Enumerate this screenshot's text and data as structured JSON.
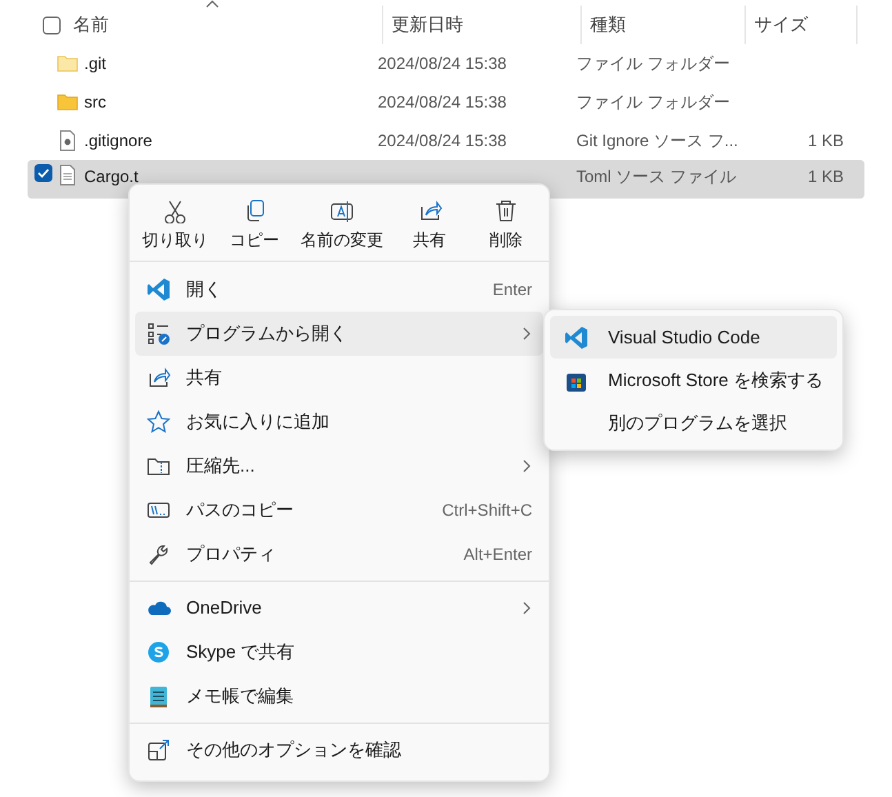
{
  "file_list": {
    "select_all": {
      "checked": false
    },
    "columns": [
      "名前",
      "更新日時",
      "種類",
      "サイズ"
    ],
    "rows": [
      {
        "name": ".git",
        "modified": "2024/08/24 15:38",
        "type": "ファイル フォルダー",
        "size": "",
        "selected": false
      },
      {
        "name": "src",
        "modified": "2024/08/24 15:38",
        "type": "ファイル フォルダー",
        "size": "",
        "selected": false
      },
      {
        "name": ".gitignore",
        "modified": "2024/08/24 15:38",
        "type": "Git Ignore ソース フ...",
        "size": "1 KB",
        "selected": false
      },
      {
        "name": "Cargo.t",
        "type": "Toml ソース ファイル",
        "size": "1 KB",
        "selected": true
      }
    ]
  },
  "context_menu": {
    "toolbar": [
      "切り取り",
      "コピー",
      "名前の変更",
      "共有",
      "削除"
    ],
    "groups": [
      [
        {
          "label": "開く",
          "shortcut": "Enter",
          "submenu": false,
          "selected": false
        },
        {
          "label": "プログラムから開く",
          "submenu": true,
          "selected": true
        },
        {
          "label": "共有",
          "submenu": false,
          "selected": false
        },
        {
          "label": "お気に入りに追加",
          "submenu": false,
          "selected": false
        },
        {
          "label": "圧縮先...",
          "submenu": true,
          "selected": false
        },
        {
          "label": "パスのコピー",
          "shortcut": "Ctrl+Shift+C",
          "submenu": false,
          "selected": false
        },
        {
          "label": "プロパティ",
          "shortcut": "Alt+Enter",
          "submenu": false,
          "selected": false
        }
      ],
      [
        {
          "label": "OneDrive",
          "submenu": true,
          "selected": false
        },
        {
          "label": "Skype で共有",
          "submenu": false,
          "selected": false
        },
        {
          "label": "メモ帳で編集",
          "submenu": false,
          "selected": false
        }
      ],
      [
        {
          "label": "その他のオプションを確認",
          "submenu": false,
          "selected": false
        }
      ]
    ]
  },
  "submenu": {
    "items": [
      {
        "label": "Visual Studio Code",
        "selected": true
      },
      {
        "label": "Microsoft Store を検索する",
        "selected": false
      },
      {
        "label": "別のプログラムを選択",
        "selected": false
      }
    ]
  }
}
